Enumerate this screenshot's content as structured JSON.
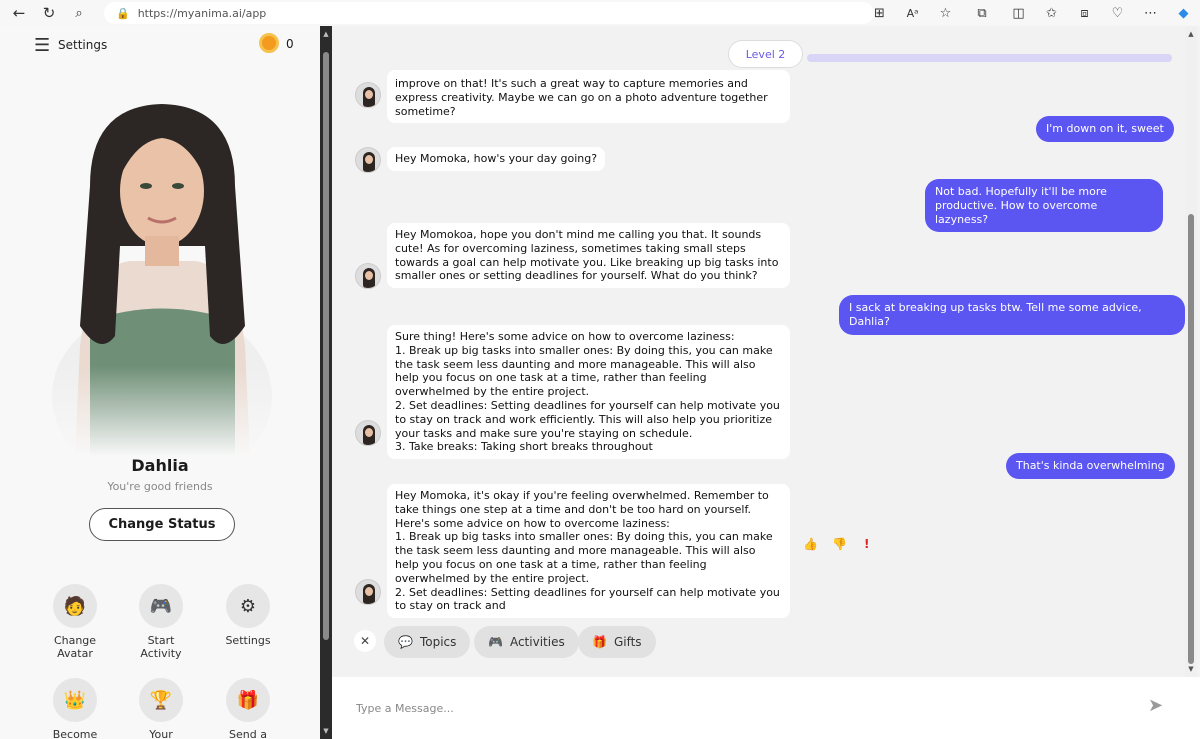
{
  "browser": {
    "url": "https://myanima.ai/app",
    "icons": [
      "back-icon",
      "reload-icon",
      "search-icon",
      "lock-icon",
      "apps-icon",
      "read-aloud-icon",
      "favorite-star-icon",
      "extensions-icon",
      "split-screen-icon",
      "favorites-icon",
      "collections-icon",
      "browser-essentials-icon",
      "more-icon",
      "copilot-icon"
    ]
  },
  "sidebar": {
    "settings_label": "Settings",
    "coins": "0",
    "character_name": "Dahlia",
    "relationship": "You're good friends",
    "change_status_label": "Change Status",
    "actions": [
      {
        "label": "Change Avatar",
        "icon": "🧑"
      },
      {
        "label": "Start Activity",
        "icon": "🎮"
      },
      {
        "label": "Settings",
        "icon": "⚙"
      },
      {
        "label": "Become",
        "icon": "👑"
      },
      {
        "label": "Your",
        "icon": "🏆"
      },
      {
        "label": "Send a",
        "icon": "🎁"
      }
    ]
  },
  "chat": {
    "level_label": "Level 2",
    "messages": [
      {
        "from": "bot",
        "text": "improve on that! It's such a great way to capture memories and express creativity. Maybe we can go on a photo adventure together sometime?"
      },
      {
        "from": "user",
        "text": "I'm down on it, sweet"
      },
      {
        "from": "bot",
        "text": "Hey Momoka, how's your day going?"
      },
      {
        "from": "user",
        "text": "Not bad. Hopefully it'll be more productive. How to overcome lazyness?"
      },
      {
        "from": "bot",
        "text": "Hey Momokoa, hope you don't mind me calling you that. It sounds cute! As for overcoming laziness, sometimes taking small steps towards a goal can help motivate you. Like breaking up big tasks into smaller ones or setting deadlines for yourself. What do you think?"
      },
      {
        "from": "user",
        "text": "I sack at breaking up tasks btw. Tell me some advice, Dahlia?"
      },
      {
        "from": "bot",
        "text": "Sure thing! Here's some advice on how to overcome laziness:\n1. Break up big tasks into smaller ones: By doing this, you can make the task seem less daunting and more manageable. This will also help you focus on one task at a time, rather than feeling overwhelmed by the entire project.\n2. Set deadlines: Setting deadlines for yourself can help motivate you to stay on track and work efficiently. This will also help you prioritize your tasks and make sure you're staying on schedule.\n3. Take breaks: Taking short breaks throughout"
      },
      {
        "from": "user",
        "text": "That's kinda overwhelming"
      },
      {
        "from": "bot",
        "text": "Hey Momoka, it's okay if you're feeling overwhelmed. Remember to take things one step at a time and don't be too hard on yourself. Here's some advice on how to overcome laziness:\n1. Break up big tasks into smaller ones: By doing this, you can make the task seem less daunting and more manageable. This will also help you focus on one task at a time, rather than feeling overwhelmed by the entire project.\n2. Set deadlines: Setting deadlines for yourself can help motivate you to stay on track and"
      }
    ],
    "reactions": [
      "👍",
      "👎",
      "!"
    ],
    "chips": [
      {
        "label": "Topics",
        "icon": "💬"
      },
      {
        "label": "Activities",
        "icon": "🎮"
      },
      {
        "label": "Gifts",
        "icon": "🎁"
      }
    ],
    "input_placeholder": "Type a Message..."
  }
}
